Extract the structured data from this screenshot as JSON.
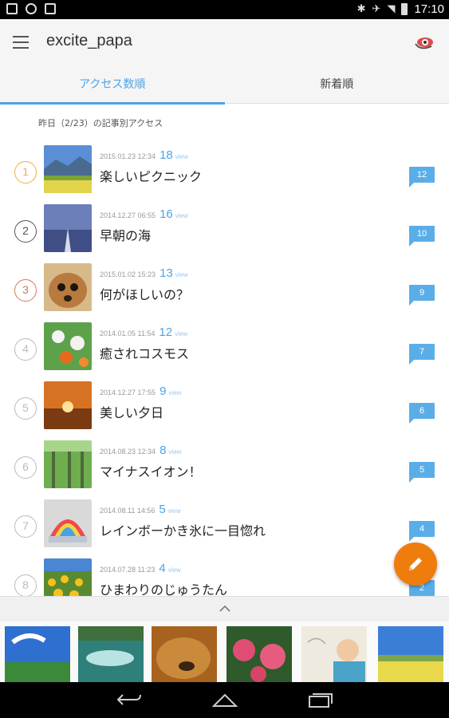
{
  "status_bar": {
    "time": "17:10"
  },
  "app_bar": {
    "title": "excite_papa"
  },
  "tabs": [
    {
      "label": "アクセス数順",
      "active": true
    },
    {
      "label": "新着順",
      "active": false
    }
  ],
  "caption": "昨日（2/23）の記事別アクセス",
  "list": [
    {
      "rank": "1",
      "date": "2015.01.23 12:34",
      "views": "18",
      "unit": "view",
      "title": "楽しいピクニック",
      "comments": "12",
      "rank_color": "#e8b04a",
      "thumb": "picnic"
    },
    {
      "rank": "2",
      "date": "2014.12.27 06:55",
      "views": "16",
      "unit": "view",
      "title": "早朝の海",
      "comments": "10",
      "rank_color": "#555555",
      "thumb": "sea"
    },
    {
      "rank": "3",
      "date": "2015.01.02 15:23",
      "views": "13",
      "unit": "view",
      "title": "何がほしいの？",
      "comments": "9",
      "rank_color": "#d9775a",
      "thumb": "dog"
    },
    {
      "rank": "4",
      "date": "2014.01.05 11:54",
      "views": "12",
      "unit": "view",
      "title": "癒されコスモス",
      "comments": "7",
      "rank_color": "#bbbbbb",
      "thumb": "cosmos"
    },
    {
      "rank": "5",
      "date": "2014.12.27 17:55",
      "views": "9",
      "unit": "view",
      "title": "美しい夕日",
      "comments": "6",
      "rank_color": "#bbbbbb",
      "thumb": "sunset"
    },
    {
      "rank": "6",
      "date": "2014.08.23 12:34",
      "views": "8",
      "unit": "view",
      "title": "マイナスイオン！",
      "comments": "5",
      "rank_color": "#bbbbbb",
      "thumb": "forest"
    },
    {
      "rank": "7",
      "date": "2014.08.11 14:56",
      "views": "5",
      "unit": "view",
      "title": "レインボーかき氷に一目惚れ",
      "comments": "4",
      "rank_color": "#bbbbbb",
      "thumb": "shavedice"
    },
    {
      "rank": "8",
      "date": "2014.07.28 11:23",
      "views": "4",
      "unit": "view",
      "title": "ひまわりのじゅうたん",
      "comments": "2",
      "rank_color": "#bbbbbb",
      "thumb": "sunflower"
    }
  ],
  "icons": {
    "menu": "menu-icon",
    "eye": "eye-icon",
    "fab": "pencil-icon",
    "expand": "chevron-up-icon",
    "nav": [
      "back-icon",
      "home-icon",
      "recents-icon"
    ]
  },
  "colors": {
    "accent": "#4ea3e6",
    "fab": "#ef7d0e",
    "bubble": "#5aaee8"
  }
}
